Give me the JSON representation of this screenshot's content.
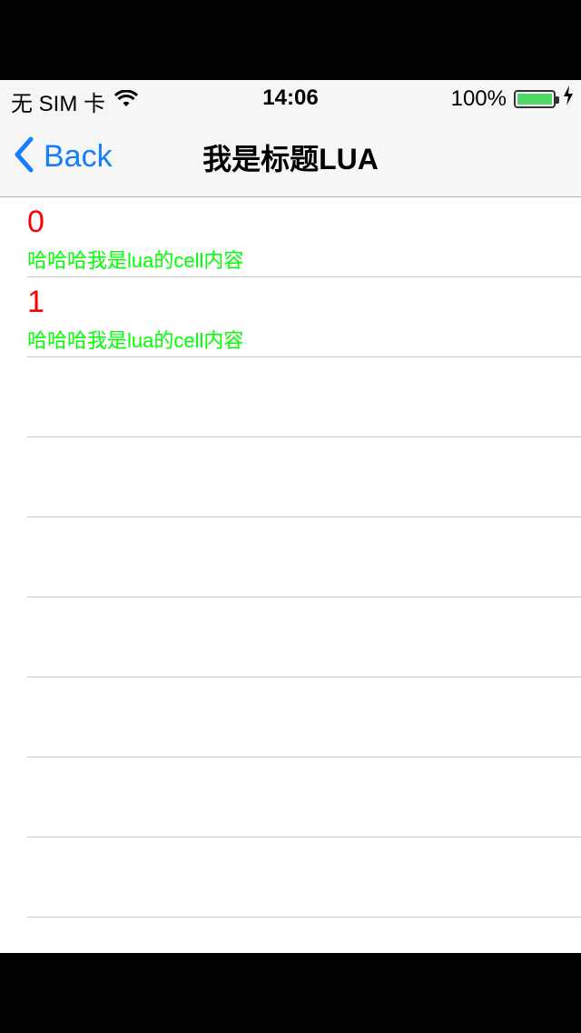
{
  "status_bar": {
    "carrier": "无 SIM 卡",
    "time": "14:06",
    "battery": "100%",
    "battery_level": 1.0,
    "battery_color": "#4cd964"
  },
  "navbar": {
    "back_label": "Back",
    "title": "我是标题LUA",
    "accent_color": "#157efb"
  },
  "rows": [
    {
      "number": "0",
      "subtitle": "哈哈哈我是lua的cell内容"
    },
    {
      "number": "1",
      "subtitle": "哈哈哈我是lua的cell内容"
    },
    {
      "number": "",
      "subtitle": ""
    },
    {
      "number": "",
      "subtitle": ""
    },
    {
      "number": "",
      "subtitle": ""
    },
    {
      "number": "",
      "subtitle": ""
    },
    {
      "number": "",
      "subtitle": ""
    },
    {
      "number": "",
      "subtitle": ""
    },
    {
      "number": "",
      "subtitle": ""
    }
  ],
  "colors": {
    "number_color": "#ff0000",
    "subtitle_color": "#00ff00"
  }
}
